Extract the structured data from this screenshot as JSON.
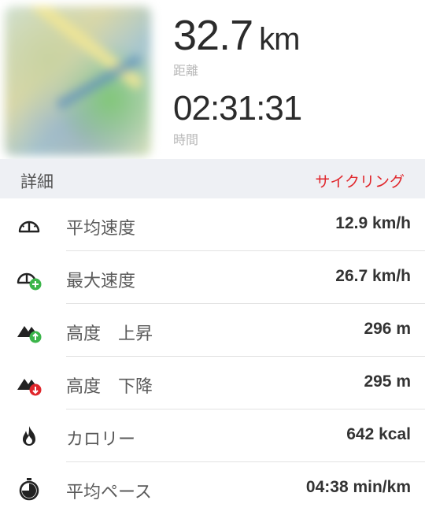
{
  "summary": {
    "distance_value": "32.7",
    "distance_unit": "km",
    "distance_label": "距離",
    "duration_value": "02:31:31",
    "duration_label": "時間"
  },
  "details": {
    "header": "詳細",
    "activity": "サイクリング",
    "accent_color": "#e0262b"
  },
  "rows": [
    {
      "icon": "speedometer-icon",
      "label": "平均速度",
      "value": "12.9 km/h"
    },
    {
      "icon": "max-speed-icon",
      "label": "最大速度",
      "value": "26.7 km/h"
    },
    {
      "icon": "elevation-up-icon",
      "label": "高度　上昇",
      "value": "296 m"
    },
    {
      "icon": "elevation-down-icon",
      "label": "高度　下降",
      "value": "295 m"
    },
    {
      "icon": "flame-icon",
      "label": "カロリー",
      "value": "642 kcal"
    },
    {
      "icon": "stopwatch-icon",
      "label": "平均ペース",
      "value": "04:38 min/km"
    }
  ]
}
